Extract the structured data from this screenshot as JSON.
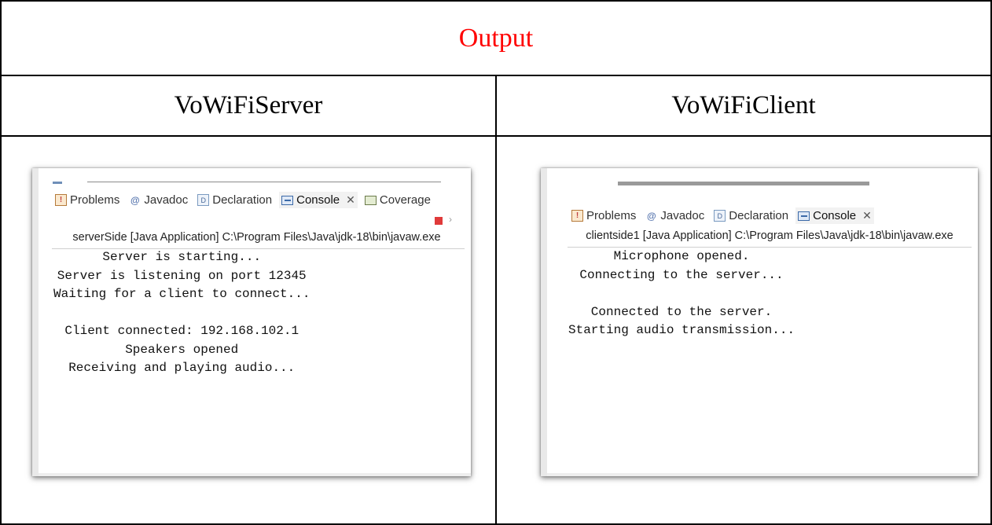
{
  "document": {
    "title": "Output",
    "title_color": "#ff0000",
    "columns": [
      "VoWiFiServer",
      "VoWiFiClient"
    ]
  },
  "server_console": {
    "tabs": [
      {
        "label": "Problems",
        "icon": "problems-icon"
      },
      {
        "label": "Javadoc",
        "icon": "javadoc-icon"
      },
      {
        "label": "Declaration",
        "icon": "declaration-icon"
      },
      {
        "label": "Console",
        "icon": "console-icon",
        "active": true
      },
      {
        "label": "Coverage",
        "icon": "coverage-icon"
      }
    ],
    "launch_text": "serverSide [Java Application] C:\\Program Files\\Java\\jdk-18\\bin\\javaw.exe",
    "lines": [
      "Server is starting...",
      "Server is listening on port 12345",
      "Waiting for a client to connect...",
      "",
      "Client connected: 192.168.102.1",
      "Speakers opened",
      "Receiving and playing audio..."
    ]
  },
  "client_console": {
    "tabs": [
      {
        "label": "Problems",
        "icon": "problems-icon"
      },
      {
        "label": "Javadoc",
        "icon": "javadoc-icon"
      },
      {
        "label": "Declaration",
        "icon": "declaration-icon"
      },
      {
        "label": "Console",
        "icon": "console-icon",
        "active": true
      }
    ],
    "launch_text": "clientside1 [Java Application] C:\\Program Files\\Java\\jdk-18\\bin\\javaw.exe",
    "lines": [
      "Microphone opened.",
      "Connecting to the server...",
      "",
      "Connected to the server.",
      "Starting audio transmission..."
    ]
  }
}
